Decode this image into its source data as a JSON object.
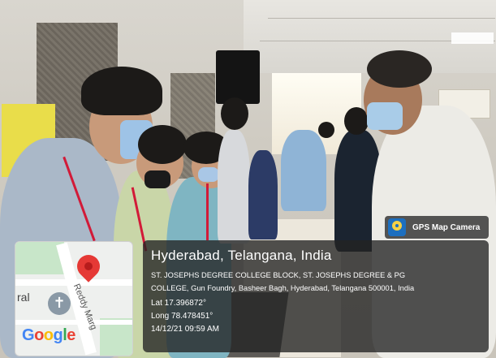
{
  "overlay": {
    "badge": {
      "icon": "gps-map-camera-icon",
      "label": "GPS Map Camera"
    },
    "location_title": "Hyderabad, Telangana, India",
    "address_line1": "ST. JOSEPHS DEGREE COLLEGE BLOCK, ST. JOSEPHS DEGREE & PG",
    "address_line2": "COLLEGE, Gun Foundry, Basheer Bagh, Hyderabad, Telangana 500001, India",
    "latitude": "Lat 17.396872°",
    "longitude": "Long 78.478451°",
    "timestamp": "14/12/21 09:59 AM",
    "map": {
      "street_label": "Reddy Marg",
      "side_label": "ral",
      "pin_icon": "location-pin-icon",
      "place_icon": "church-icon",
      "brand": "Google"
    }
  }
}
